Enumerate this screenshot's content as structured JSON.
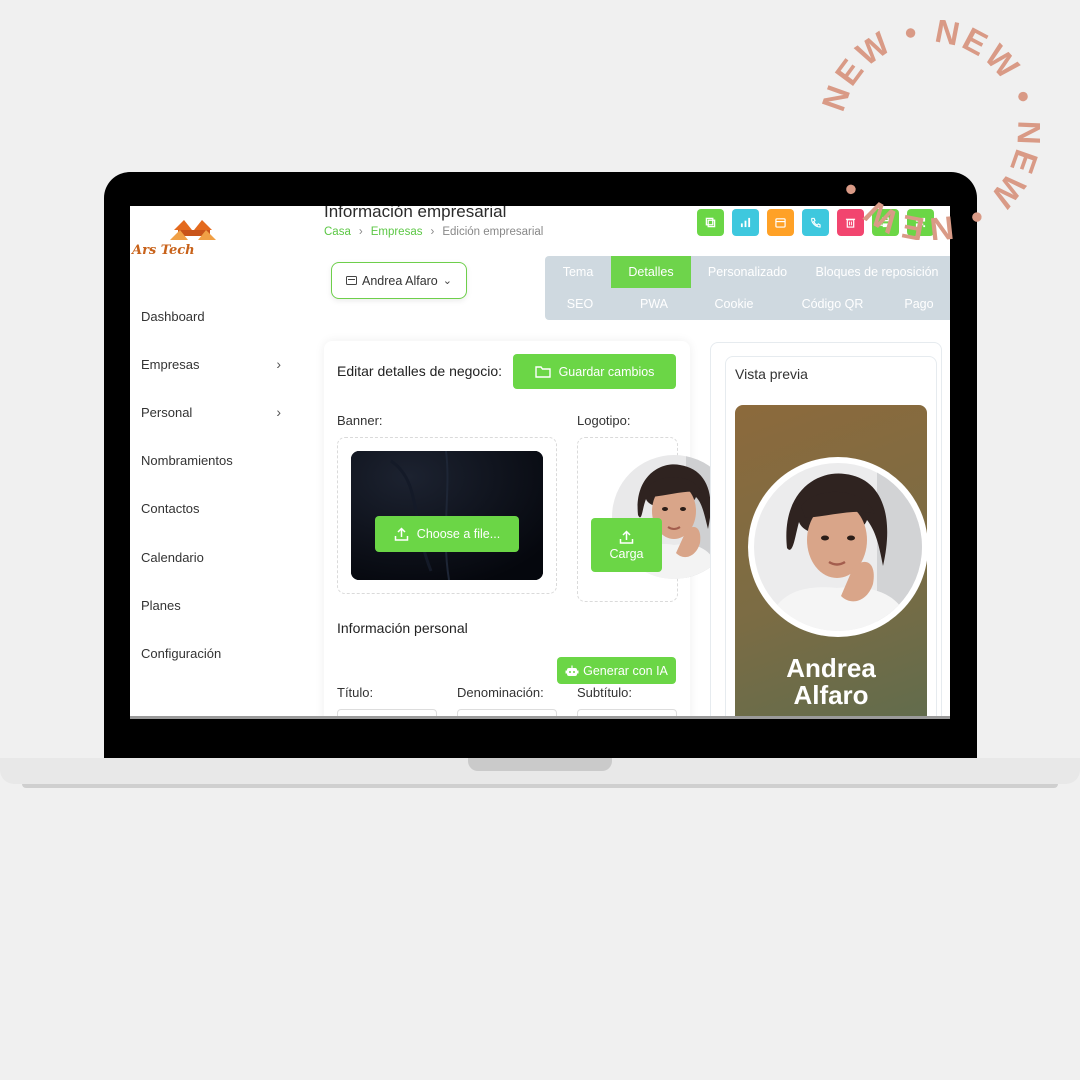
{
  "app": {
    "logo_text": "Ars Tech"
  },
  "header": {
    "title": "Información empresarial",
    "breadcrumb": [
      "Casa",
      "Empresas",
      "Edición empresarial"
    ]
  },
  "sidebar": {
    "items": [
      {
        "label": "Dashboard",
        "has_children": false
      },
      {
        "label": "Empresas",
        "has_children": true
      },
      {
        "label": "Personal",
        "has_children": true
      },
      {
        "label": "Nombramientos",
        "has_children": false
      },
      {
        "label": "Contactos",
        "has_children": false
      },
      {
        "label": "Calendario",
        "has_children": false
      },
      {
        "label": "Planes",
        "has_children": false
      },
      {
        "label": "Configuración",
        "has_children": false
      }
    ]
  },
  "toolbar": {
    "buttons": [
      {
        "icon": "copy-icon",
        "color": "#6bd646"
      },
      {
        "icon": "chart-icon",
        "color": "#3ec8de"
      },
      {
        "icon": "calendar-icon",
        "color": "#ffa126"
      },
      {
        "icon": "phone-icon",
        "color": "#3ec8de"
      },
      {
        "icon": "trash-icon",
        "color": "#f2456f"
      },
      {
        "icon": "print-icon",
        "color": "#6bd646"
      },
      {
        "icon": "qr-icon",
        "color": "#6bd646"
      }
    ]
  },
  "user_select": {
    "value": "Andrea Alfaro"
  },
  "tabs": {
    "row1": [
      "Tema",
      "Detalles",
      "Personalizado",
      "Bloques de reposición"
    ],
    "row2": [
      "SEO",
      "PWA",
      "Cookie",
      "Código QR",
      "Pago"
    ],
    "active": "Detalles"
  },
  "form": {
    "title": "Editar detalles de negocio:",
    "save_label": "Guardar cambios",
    "banner_label": "Banner:",
    "logo_label": "Logotipo:",
    "choose_file_label": "Choose a file...",
    "upload_label": "Carga",
    "personal_info_title": "Información personal",
    "generate_ai_label": "Generar con IA",
    "title_field_label": "Título:",
    "denomination_label": "Denominación:",
    "subtitle_label": "Subtítulo:"
  },
  "preview": {
    "title": "Vista previa",
    "name_line1": "Andrea",
    "name_line2": "Alfaro"
  },
  "badge": {
    "text": "NEW • NEW • NEW • NEW • "
  },
  "colors": {
    "accent": "#6bd646",
    "tabs_bg": "#cfd9e0",
    "badge": "#d99a86"
  }
}
